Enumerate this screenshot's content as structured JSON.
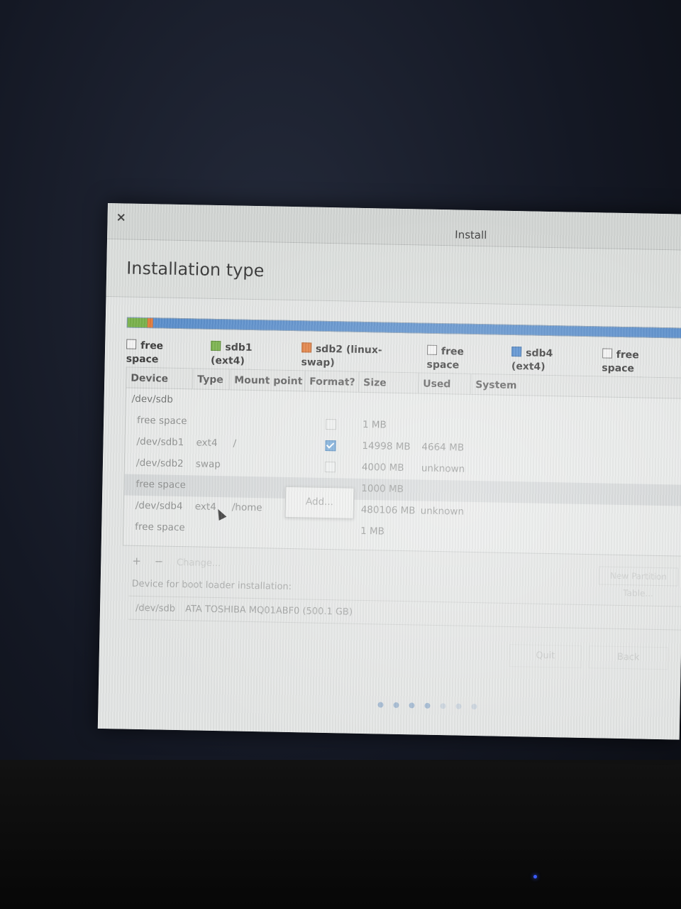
{
  "window": {
    "title": "Install",
    "close_glyph": "×"
  },
  "header": {
    "title": "Installation type"
  },
  "legend": [
    {
      "label": "free space",
      "size": "1.0 MB",
      "color": "#f3f3f3"
    },
    {
      "label": "sdb1 (ext4)",
      "size": "15.0 GB",
      "color": "#78b14a"
    },
    {
      "label": "sdb2 (linux-swap)",
      "size": "4.0 GB",
      "color": "#e07a3a"
    },
    {
      "label": "free space",
      "size": "1.0 GB",
      "color": "#f3f3f3"
    },
    {
      "label": "sdb4 (ext4)",
      "size": "480.1 GB",
      "color": "#4c87cc"
    },
    {
      "label": "free space",
      "size": "1.1 MB",
      "color": "#f3f3f3"
    }
  ],
  "table": {
    "columns": [
      "Device",
      "Type",
      "Mount point",
      "Format?",
      "Size",
      "Used",
      "System"
    ],
    "rows": [
      {
        "device": "/dev/sdb",
        "type": "",
        "mount": "",
        "format": null,
        "size": "",
        "used": "",
        "system": ""
      },
      {
        "device": "free space",
        "type": "",
        "mount": "",
        "format": false,
        "size": "1 MB",
        "used": "",
        "system": ""
      },
      {
        "device": "/dev/sdb1",
        "type": "ext4",
        "mount": "/",
        "format": true,
        "size": "14998 MB",
        "used": "4664 MB",
        "system": ""
      },
      {
        "device": "/dev/sdb2",
        "type": "swap",
        "mount": "",
        "format": false,
        "size": "4000 MB",
        "used": "unknown",
        "system": ""
      },
      {
        "device": "free space",
        "type": "",
        "mount": "",
        "format": null,
        "size": "1000 MB",
        "used": "",
        "system": ""
      },
      {
        "device": "/dev/sdb4",
        "type": "ext4",
        "mount": "/home",
        "format": null,
        "size": "480106 MB",
        "used": "unknown",
        "system": ""
      },
      {
        "device": "free space",
        "type": "",
        "mount": "",
        "format": null,
        "size": "1 MB",
        "used": "",
        "system": ""
      }
    ]
  },
  "context_menu": {
    "add_label": "Add..."
  },
  "toolbar": {
    "add_glyph": "+",
    "remove_glyph": "−",
    "change_label": "Change...",
    "new_table_label": "New Partition Table..."
  },
  "boot": {
    "label": "Device for boot loader installation:",
    "device": "/dev/sdb",
    "name": "ATA TOSHIBA MQ01ABF0 (500.1 GB)"
  },
  "buttons": {
    "quit": "Quit",
    "back": "Back"
  },
  "colors": {
    "accent_blue": "#5a8ecb",
    "ext4_green": "#78b14a",
    "swap_orange": "#e07a3a"
  }
}
